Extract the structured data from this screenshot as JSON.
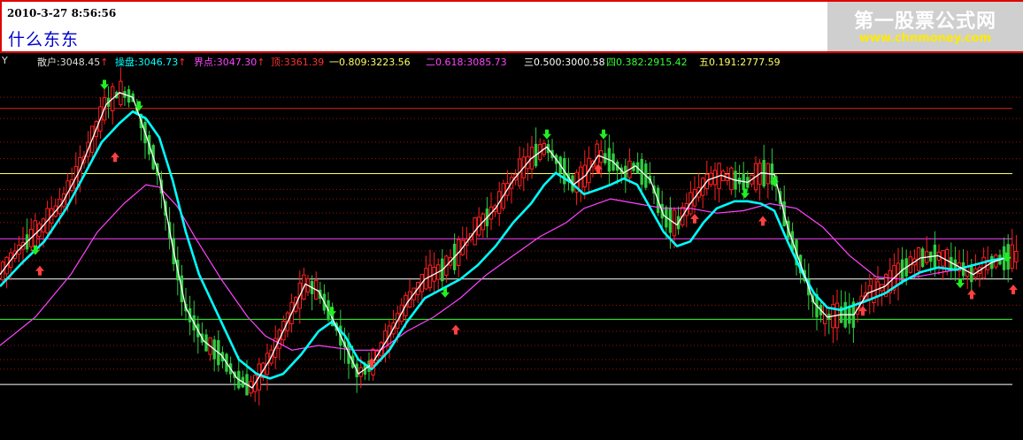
{
  "header": {
    "timestamp": "2010-3-27 8:56:56",
    "title": "什么东东",
    "logo_text": "第一股票公式网",
    "logo_url": "www.chnmoney.com"
  },
  "axis_label": "Y",
  "indicators": [
    {
      "label": "散户:3048.45",
      "arrow": "↑",
      "color": "#dddddd",
      "arrow_color": "#ff3030"
    },
    {
      "label": "操盘:3046.73",
      "arrow": "↑",
      "color": "#00ffff",
      "arrow_color": "#ff3030"
    },
    {
      "label": "界点:3047.30",
      "arrow": "↑",
      "color": "#ff44ff",
      "arrow_color": "#ff3030"
    },
    {
      "label": "顶:3361.39",
      "arrow": "",
      "color": "#ff3030",
      "arrow_color": ""
    },
    {
      "label": "一0.809:3223.56",
      "arrow": "",
      "color": "#ffff66",
      "arrow_color": ""
    },
    {
      "label": "二0.618:3085.73",
      "arrow": "",
      "color": "#ff44ff",
      "arrow_color": ""
    },
    {
      "label": "三0.500:3000.58",
      "arrow": "",
      "color": "#ffffff",
      "arrow_color": ""
    },
    {
      "label": "四0.382:2915.42",
      "arrow": "",
      "color": "#33ff33",
      "arrow_color": ""
    },
    {
      "label": "五0.191:2777.59",
      "arrow": "",
      "color": "#ffff66",
      "arrow_color": ""
    }
  ],
  "chart_data": {
    "type": "candlestick",
    "title": "",
    "xlabel": "",
    "ylabel": "",
    "ylim": [
      2660,
      3445
    ],
    "levels": [
      {
        "name": "顶",
        "value": 3361.39,
        "color": "#e02020"
      },
      {
        "name": "一0.809",
        "value": 3223.56,
        "color": "#ffff66"
      },
      {
        "name": "二0.618",
        "value": 3085.73,
        "color": "#ff44ff"
      },
      {
        "name": "三0.500",
        "value": 3000.58,
        "color": "#ffffff"
      },
      {
        "name": "四0.382",
        "value": 2915.42,
        "color": "#33ff33"
      },
      {
        "name": "五0.191",
        "value": 2777.59,
        "color": "#ffffff"
      }
    ],
    "dotted_levels": [
      3385,
      3340,
      3290,
      3255,
      3190,
      3170,
      3140,
      3120,
      3060,
      3040,
      2945,
      2890,
      2860,
      2830,
      2810
    ],
    "series": [
      {
        "name": "散户",
        "color": "#ffffff",
        "width": 1.3,
        "values": [
          [
            0,
            3010
          ],
          [
            20,
            3060
          ],
          [
            45,
            3105
          ],
          [
            70,
            3160
          ],
          [
            90,
            3230
          ],
          [
            105,
            3300
          ],
          [
            120,
            3370
          ],
          [
            135,
            3395
          ],
          [
            150,
            3385
          ],
          [
            165,
            3305
          ],
          [
            180,
            3220
          ],
          [
            195,
            3070
          ],
          [
            210,
            2940
          ],
          [
            230,
            2870
          ],
          [
            250,
            2840
          ],
          [
            268,
            2790
          ],
          [
            285,
            2770
          ],
          [
            305,
            2830
          ],
          [
            325,
            2910
          ],
          [
            345,
            2990
          ],
          [
            360,
            2975
          ],
          [
            375,
            2920
          ],
          [
            390,
            2860
          ],
          [
            405,
            2800
          ],
          [
            420,
            2820
          ],
          [
            440,
            2880
          ],
          [
            460,
            2950
          ],
          [
            480,
            3000
          ],
          [
            500,
            3020
          ],
          [
            520,
            3060
          ],
          [
            540,
            3110
          ],
          [
            560,
            3150
          ],
          [
            580,
            3210
          ],
          [
            600,
            3255
          ],
          [
            618,
            3280
          ],
          [
            632,
            3245
          ],
          [
            648,
            3200
          ],
          [
            662,
            3220
          ],
          [
            676,
            3262
          ],
          [
            692,
            3250
          ],
          [
            705,
            3225
          ],
          [
            718,
            3240
          ],
          [
            735,
            3210
          ],
          [
            750,
            3135
          ],
          [
            765,
            3115
          ],
          [
            780,
            3160
          ],
          [
            800,
            3210
          ],
          [
            815,
            3220
          ],
          [
            830,
            3210
          ],
          [
            845,
            3205
          ],
          [
            860,
            3225
          ],
          [
            875,
            3222
          ],
          [
            890,
            3110
          ],
          [
            905,
            3030
          ],
          [
            920,
            2950
          ],
          [
            935,
            2920
          ],
          [
            950,
            2925
          ],
          [
            965,
            2925
          ],
          [
            980,
            2970
          ],
          [
            1000,
            2985
          ],
          [
            1020,
            3020
          ],
          [
            1040,
            3045
          ],
          [
            1060,
            3050
          ],
          [
            1080,
            3030
          ],
          [
            1100,
            3010
          ],
          [
            1120,
            3035
          ],
          [
            1140,
            3048
          ]
        ]
      },
      {
        "name": "操盘",
        "color": "#00ffff",
        "width": 2.6,
        "values": [
          [
            0,
            2985
          ],
          [
            25,
            3035
          ],
          [
            50,
            3080
          ],
          [
            75,
            3150
          ],
          [
            95,
            3220
          ],
          [
            115,
            3290
          ],
          [
            135,
            3330
          ],
          [
            150,
            3355
          ],
          [
            165,
            3340
          ],
          [
            180,
            3300
          ],
          [
            195,
            3210
          ],
          [
            210,
            3100
          ],
          [
            225,
            3010
          ],
          [
            240,
            2950
          ],
          [
            255,
            2890
          ],
          [
            270,
            2830
          ],
          [
            290,
            2800
          ],
          [
            305,
            2790
          ],
          [
            320,
            2800
          ],
          [
            340,
            2840
          ],
          [
            360,
            2890
          ],
          [
            375,
            2910
          ],
          [
            390,
            2880
          ],
          [
            405,
            2830
          ],
          [
            420,
            2810
          ],
          [
            440,
            2850
          ],
          [
            460,
            2910
          ],
          [
            480,
            2960
          ],
          [
            500,
            2980
          ],
          [
            520,
            3000
          ],
          [
            540,
            3030
          ],
          [
            560,
            3070
          ],
          [
            580,
            3120
          ],
          [
            600,
            3160
          ],
          [
            615,
            3200
          ],
          [
            628,
            3225
          ],
          [
            645,
            3205
          ],
          [
            660,
            3180
          ],
          [
            676,
            3190
          ],
          [
            690,
            3200
          ],
          [
            705,
            3213
          ],
          [
            720,
            3200
          ],
          [
            735,
            3150
          ],
          [
            750,
            3100
          ],
          [
            765,
            3070
          ],
          [
            780,
            3080
          ],
          [
            795,
            3120
          ],
          [
            810,
            3150
          ],
          [
            830,
            3165
          ],
          [
            845,
            3165
          ],
          [
            860,
            3160
          ],
          [
            875,
            3145
          ],
          [
            890,
            3080
          ],
          [
            905,
            3020
          ],
          [
            920,
            2970
          ],
          [
            935,
            2940
          ],
          [
            950,
            2935
          ],
          [
            965,
            2945
          ],
          [
            980,
            2955
          ],
          [
            1000,
            2970
          ],
          [
            1020,
            2995
          ],
          [
            1040,
            3015
          ],
          [
            1060,
            3025
          ],
          [
            1080,
            3020
          ],
          [
            1100,
            3030
          ],
          [
            1120,
            3040
          ],
          [
            1140,
            3046
          ]
        ]
      },
      {
        "name": "界点",
        "color": "#ff44ff",
        "width": 1.2,
        "values": [
          [
            0,
            2860
          ],
          [
            40,
            2920
          ],
          [
            80,
            3010
          ],
          [
            110,
            3100
          ],
          [
            140,
            3160
          ],
          [
            165,
            3200
          ],
          [
            180,
            3195
          ],
          [
            200,
            3155
          ],
          [
            220,
            3090
          ],
          [
            250,
            3000
          ],
          [
            280,
            2920
          ],
          [
            300,
            2880
          ],
          [
            330,
            2850
          ],
          [
            360,
            2860
          ],
          [
            380,
            2855
          ],
          [
            400,
            2850
          ],
          [
            430,
            2850
          ],
          [
            460,
            2890
          ],
          [
            490,
            2920
          ],
          [
            520,
            2960
          ],
          [
            550,
            3010
          ],
          [
            580,
            3050
          ],
          [
            610,
            3090
          ],
          [
            640,
            3120
          ],
          [
            660,
            3150
          ],
          [
            690,
            3170
          ],
          [
            720,
            3160
          ],
          [
            750,
            3150
          ],
          [
            780,
            3150
          ],
          [
            810,
            3140
          ],
          [
            840,
            3145
          ],
          [
            870,
            3160
          ],
          [
            900,
            3150
          ],
          [
            930,
            3110
          ],
          [
            960,
            3050
          ],
          [
            990,
            3005
          ],
          [
            1020,
            3000
          ],
          [
            1050,
            3010
          ],
          [
            1080,
            3020
          ],
          [
            1110,
            3035
          ],
          [
            1140,
            3047
          ]
        ]
      }
    ],
    "signals": [
      {
        "x": 40,
        "price": 3055,
        "type": "buy"
      },
      {
        "x": 45,
        "price": 3025,
        "type": "sell"
      },
      {
        "x": 118,
        "price": 3405,
        "type": "buy"
      },
      {
        "x": 130,
        "price": 3265,
        "type": "sell"
      },
      {
        "x": 157,
        "price": 3360,
        "type": "buy"
      },
      {
        "x": 375,
        "price": 2925,
        "type": "buy"
      },
      {
        "x": 420,
        "price": 2830,
        "type": "sell"
      },
      {
        "x": 503,
        "price": 2965,
        "type": "buy"
      },
      {
        "x": 515,
        "price": 2900,
        "type": "sell"
      },
      {
        "x": 618,
        "price": 3300,
        "type": "buy"
      },
      {
        "x": 676,
        "price": 3240,
        "type": "sell"
      },
      {
        "x": 682,
        "price": 3300,
        "type": "buy"
      },
      {
        "x": 785,
        "price": 3135,
        "type": "sell"
      },
      {
        "x": 842,
        "price": 3175,
        "type": "buy"
      },
      {
        "x": 862,
        "price": 3130,
        "type": "sell"
      },
      {
        "x": 875,
        "price": 3200,
        "type": "buy"
      },
      {
        "x": 975,
        "price": 2940,
        "type": "sell"
      },
      {
        "x": 1085,
        "price": 2985,
        "type": "buy"
      },
      {
        "x": 1098,
        "price": 2975,
        "type": "sell"
      },
      {
        "x": 1138,
        "price": 3040,
        "type": "buy"
      },
      {
        "x": 1145,
        "price": 2985,
        "type": "sell"
      }
    ]
  }
}
